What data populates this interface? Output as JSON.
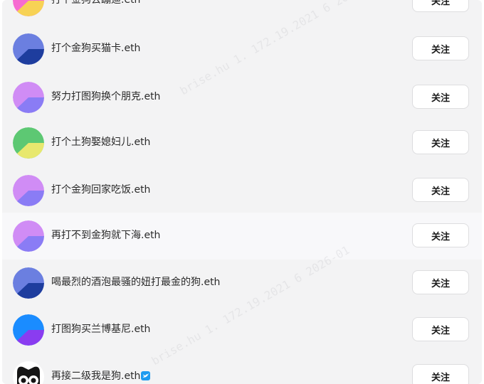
{
  "follow_label": "关注",
  "watermark_text": "brise.hu 1. 172.19.2021 6 2026-01",
  "users": [
    {
      "name": "打个金狗去蹦迪.eth",
      "avatar": "pie-pink-yellow",
      "colors": [
        "#f66bd1",
        "#f7d255"
      ]
    },
    {
      "name": "打个金狗买猫卡.eth",
      "avatar": "pie-blue",
      "colors": [
        "#6b7fe0",
        "#1e3d9e"
      ]
    },
    {
      "name": "努力打图狗换个朋克.eth",
      "avatar": "pie-violet",
      "colors": [
        "#d08cf5",
        "#8a7cf5"
      ]
    },
    {
      "name": "打个土狗娶媳妇儿.eth",
      "avatar": "pie-green-yellow",
      "colors": [
        "#5dc873",
        "#e8e86e"
      ]
    },
    {
      "name": "打个金狗回家吃饭.eth",
      "avatar": "pie-violet",
      "colors": [
        "#d08cf5",
        "#8a7cf5"
      ]
    },
    {
      "name": "再打不到金狗就下海.eth",
      "avatar": "pie-violet",
      "colors": [
        "#d08cf5",
        "#8a7cf5"
      ]
    },
    {
      "name": "喝最烈的酒泡最骚的妞打最金的狗.eth",
      "avatar": "pie-blue",
      "colors": [
        "#6b7fe0",
        "#1e3d9e"
      ]
    },
    {
      "name": "打图狗买兰博基尼.eth",
      "avatar": "pie-blue-purple",
      "colors": [
        "#1a8cff",
        "#8a3cf0"
      ]
    },
    {
      "name": "再接二级我是狗.eth",
      "avatar": "owl-avatar",
      "colors": [
        "#111111",
        "#ffffff"
      ],
      "verified": true
    }
  ]
}
